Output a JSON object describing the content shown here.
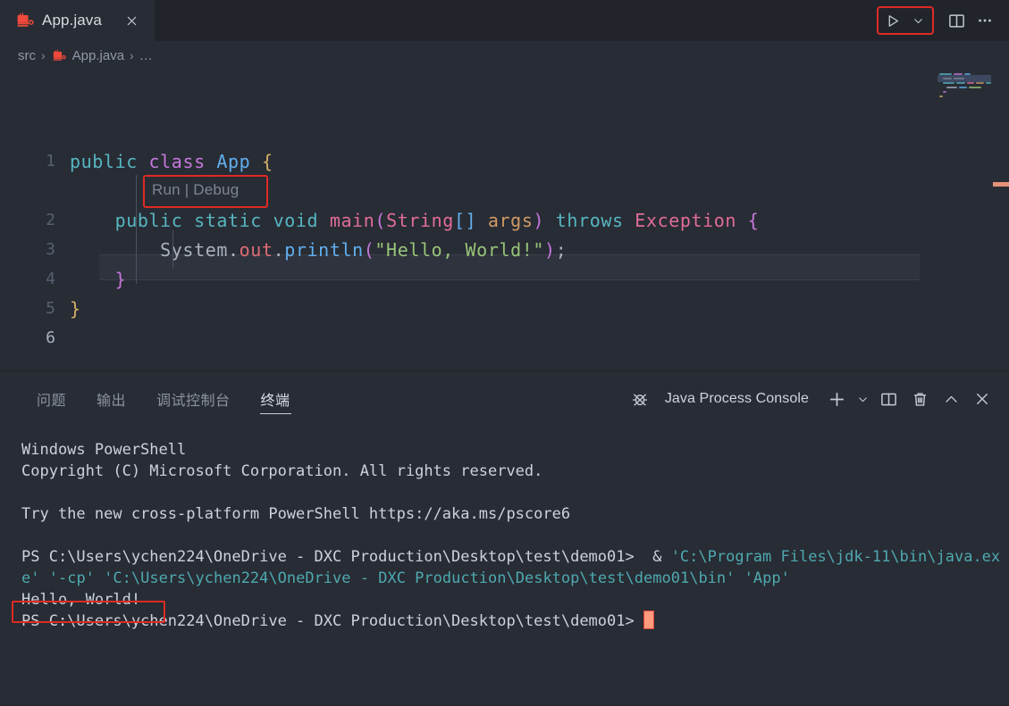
{
  "window": {
    "tab": {
      "label": "App.java",
      "icon": "java-file-icon",
      "close_icon": "close-icon"
    },
    "actions": {
      "run_icon": "run-play-icon",
      "run_dropdown_icon": "chevron-down-icon",
      "split_editor_icon": "split-editor-icon",
      "more_actions_icon": "more-actions-icon"
    }
  },
  "breadcrumb": {
    "items": [
      {
        "label": "src",
        "icon": ""
      },
      {
        "label": "App.java",
        "icon": "java-file-icon"
      },
      {
        "label": "…",
        "icon": ""
      }
    ],
    "separator": "›"
  },
  "editor": {
    "codelens": "Run | Debug",
    "line_numbers": [
      "1",
      "2",
      "3",
      "4",
      "5",
      "6"
    ],
    "active_line": "6",
    "lines": [
      {
        "n": "1",
        "tokens": [
          {
            "t": "public",
            "c": "t-kw"
          },
          {
            "t": " ",
            "c": "t-punct"
          },
          {
            "t": "class",
            "c": "t-ctrl"
          },
          {
            "t": " ",
            "c": "t-punct"
          },
          {
            "t": "App",
            "c": "t-cls"
          },
          {
            "t": " ",
            "c": "t-punct"
          },
          {
            "t": "{",
            "c": "t-brace-y"
          }
        ]
      },
      {
        "n": "2",
        "tokens": [
          {
            "t": "    ",
            "c": "t-punct"
          },
          {
            "t": "public",
            "c": "t-kw"
          },
          {
            "t": " ",
            "c": "t-punct"
          },
          {
            "t": "static",
            "c": "t-kw"
          },
          {
            "t": " ",
            "c": "t-punct"
          },
          {
            "t": "void",
            "c": "t-kw"
          },
          {
            "t": " ",
            "c": "t-punct"
          },
          {
            "t": "main",
            "c": "t-type"
          },
          {
            "t": "(",
            "c": "t-brace-p"
          },
          {
            "t": "String",
            "c": "t-type"
          },
          {
            "t": "[]",
            "c": "t-brace-b"
          },
          {
            "t": " ",
            "c": "t-punct"
          },
          {
            "t": "args",
            "c": "t-var"
          },
          {
            "t": ")",
            "c": "t-brace-p"
          },
          {
            "t": " ",
            "c": "t-punct"
          },
          {
            "t": "throws",
            "c": "t-kw"
          },
          {
            "t": " ",
            "c": "t-punct"
          },
          {
            "t": "Exception",
            "c": "t-type"
          },
          {
            "t": " ",
            "c": "t-punct"
          },
          {
            "t": "{",
            "c": "t-brace-p"
          }
        ]
      },
      {
        "n": "3",
        "tokens": [
          {
            "t": "        ",
            "c": "t-punct"
          },
          {
            "t": "System",
            "c": "t-ident"
          },
          {
            "t": ".",
            "c": "t-punct"
          },
          {
            "t": "out",
            "c": "t-prop"
          },
          {
            "t": ".",
            "c": "t-punct"
          },
          {
            "t": "println",
            "c": "t-fn"
          },
          {
            "t": "(",
            "c": "t-brace-p"
          },
          {
            "t": "\"Hello, World!\"",
            "c": "t-str"
          },
          {
            "t": ")",
            "c": "t-brace-p"
          },
          {
            "t": ";",
            "c": "t-punct"
          }
        ]
      },
      {
        "n": "4",
        "tokens": [
          {
            "t": "    ",
            "c": "t-punct"
          },
          {
            "t": "}",
            "c": "t-brace-p"
          }
        ]
      },
      {
        "n": "5",
        "tokens": [
          {
            "t": "}",
            "c": "t-brace-y"
          }
        ]
      },
      {
        "n": "6",
        "tokens": []
      }
    ]
  },
  "panel": {
    "tabs": [
      {
        "label": "问题",
        "active": false
      },
      {
        "label": "输出",
        "active": false
      },
      {
        "label": "调试控制台",
        "active": false
      },
      {
        "label": "终端",
        "active": true
      }
    ],
    "terminal_name": "Java Process Console",
    "terminal_icon": "debug-console-icon",
    "actions": {
      "new_terminal_icon": "plus-icon",
      "new_terminal_dropdown_icon": "chevron-down-icon",
      "split_terminal_icon": "split-terminal-icon",
      "kill_terminal_icon": "trash-icon",
      "maximize_panel_icon": "chevron-up-icon",
      "close_panel_icon": "close-icon"
    },
    "terminal_lines": [
      {
        "parts": [
          {
            "t": "Windows PowerShell",
            "c": "tnorm"
          }
        ]
      },
      {
        "parts": [
          {
            "t": "Copyright (C) Microsoft Corporation. All rights reserved.",
            "c": "tnorm"
          }
        ]
      },
      {
        "parts": [
          {
            "t": "",
            "c": "tnorm"
          }
        ]
      },
      {
        "parts": [
          {
            "t": "Try the new cross-platform PowerShell https://aka.ms/pscore6",
            "c": "tnorm"
          }
        ]
      },
      {
        "parts": [
          {
            "t": "",
            "c": "tnorm"
          }
        ]
      },
      {
        "parts": [
          {
            "t": "PS C:\\Users\\ychen224\\OneDrive - DXC Production\\Desktop\\test\\demo01>  & ",
            "c": "tnorm"
          },
          {
            "t": "'C:\\Program Files\\jdk-11\\bin\\java.exe'",
            "c": "tcyan"
          },
          {
            "t": " ",
            "c": "tnorm"
          },
          {
            "t": "'-cp'",
            "c": "tcyan"
          },
          {
            "t": " ",
            "c": "tnorm"
          },
          {
            "t": "'C:\\Users\\ychen224\\OneDrive - DXC Production\\Desktop\\test\\demo01\\bin'",
            "c": "tcyan"
          },
          {
            "t": " ",
            "c": "tnorm"
          },
          {
            "t": "'App'",
            "c": "tcyan"
          }
        ]
      },
      {
        "parts": [
          {
            "t": "Hello, World!",
            "c": "tnorm"
          }
        ]
      },
      {
        "parts": [
          {
            "t": "PS C:\\Users\\ychen224\\OneDrive - DXC Production\\Desktop\\test\\demo01> ",
            "c": "tnorm"
          }
        ],
        "cursor": true
      }
    ]
  },
  "annotations": {
    "run_button_highlight": "#e02a24",
    "codelens_highlight": "#e02a24",
    "hello_world_highlight": "#e02a24"
  }
}
